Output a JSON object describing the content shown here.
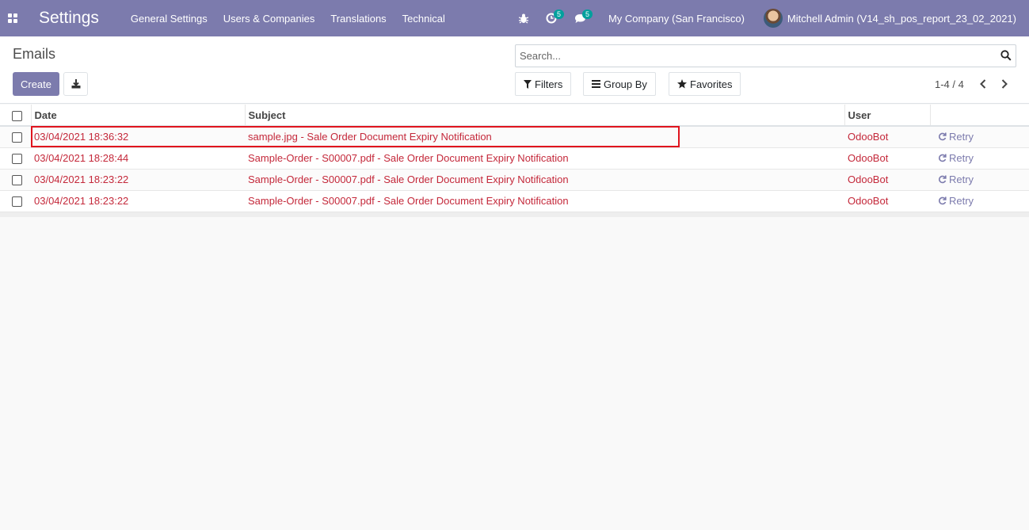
{
  "navbar": {
    "brand": "Settings",
    "menu": [
      "General Settings",
      "Users & Companies",
      "Translations",
      "Technical"
    ],
    "activity_count": "5",
    "messages_count": "5",
    "company": "My Company (San Francisco)",
    "user": "Mitchell Admin (V14_sh_pos_report_23_02_2021)",
    "color": "#7c7bad"
  },
  "control_panel": {
    "title": "Emails",
    "create_label": "Create",
    "search_placeholder": "Search...",
    "filters_label": "Filters",
    "group_by_label": "Group By",
    "favorites_label": "Favorites",
    "pager": "1-4 / 4"
  },
  "table": {
    "columns": [
      "Date",
      "Subject",
      "User"
    ],
    "rows": [
      {
        "date": "03/04/2021 18:36:32",
        "subject": "sample.jpg - Sale Order Document Expiry Notification",
        "user": "OdooBot",
        "action": "Retry"
      },
      {
        "date": "03/04/2021 18:28:44",
        "subject": "Sample-Order - S00007.pdf - Sale Order Document Expiry Notification",
        "user": "OdooBot",
        "action": "Retry"
      },
      {
        "date": "03/04/2021 18:23:22",
        "subject": "Sample-Order - S00007.pdf - Sale Order Document Expiry Notification",
        "user": "OdooBot",
        "action": "Retry"
      },
      {
        "date": "03/04/2021 18:23:22",
        "subject": "Sample-Order - S00007.pdf - Sale Order Document Expiry Notification",
        "user": "OdooBot",
        "action": "Retry"
      }
    ]
  },
  "colors": {
    "row_text": "#c4283a",
    "highlight": "#e0141e",
    "accent": "#7c7bad"
  }
}
